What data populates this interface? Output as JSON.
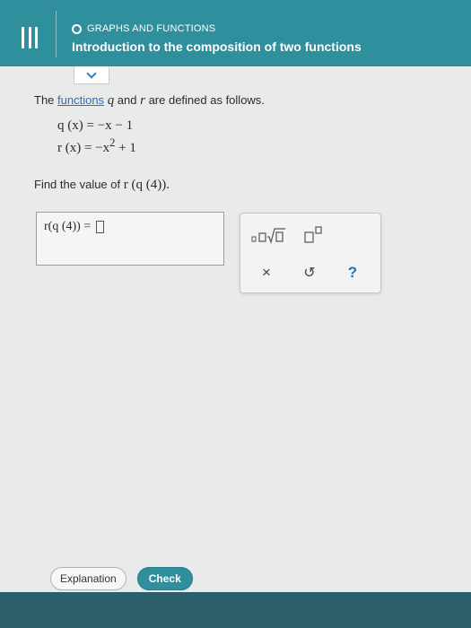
{
  "header": {
    "topic": "GRAPHS AND FUNCTIONS",
    "title": "Introduction to the composition of two functions"
  },
  "problem": {
    "intro_prefix": "The ",
    "intro_link": "functions",
    "var_q": "q",
    "intro_mid": " and ",
    "var_r": "r",
    "intro_suffix": " are defined as follows.",
    "formula_q": "q (x) = −x − 1",
    "formula_r_lhs": "r (x) = −x",
    "formula_r_exp": "2",
    "formula_r_rhs": " + 1",
    "prompt_text": "Find the value of ",
    "prompt_expr": "r (q (4))."
  },
  "answer": {
    "expression": "r(q (4)) ="
  },
  "keypad": {
    "clear_symbol": "×",
    "undo_symbol": "↺",
    "help_symbol": "?"
  },
  "footer": {
    "explanation_label": "Explanation",
    "check_label": "Check"
  },
  "colors": {
    "header_teal": "#2f8f9d",
    "link_blue": "#2f6eb5",
    "bottom_strip": "#2c5f6c"
  }
}
